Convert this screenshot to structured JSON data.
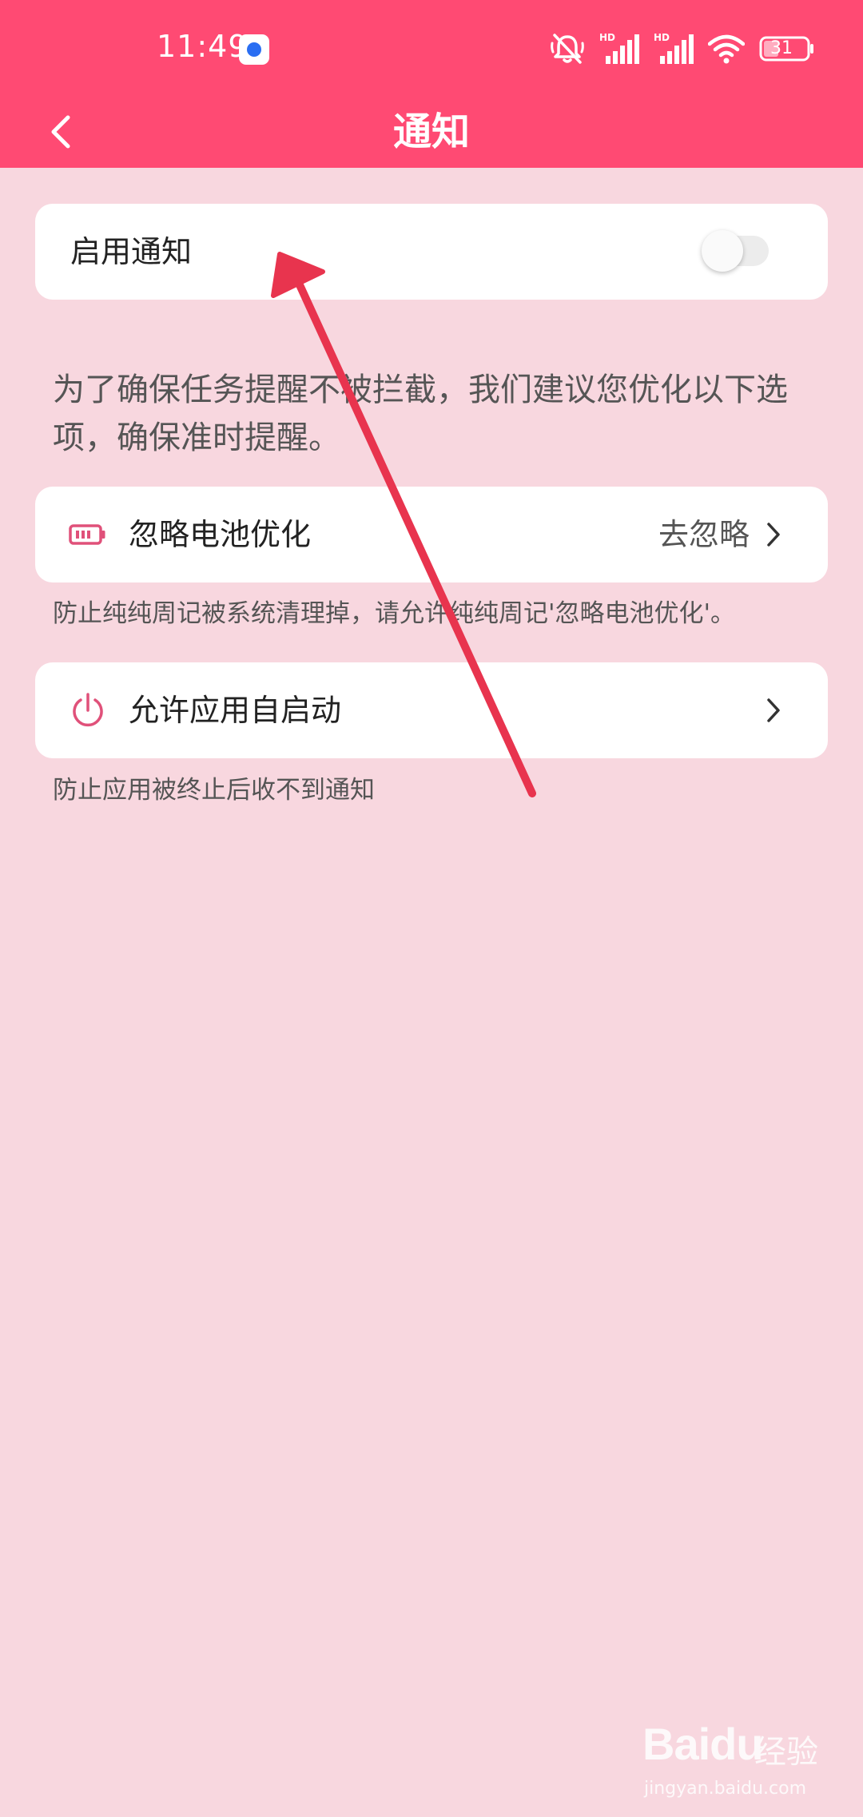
{
  "status_bar": {
    "time": "11:49",
    "battery_level": "31",
    "icons": [
      "app-notification-icon",
      "mute-icon",
      "signal-hd-icon",
      "signal-hd-icon",
      "wifi-icon",
      "battery-icon"
    ]
  },
  "nav": {
    "title": "通知",
    "back_icon": "chevron-left-icon"
  },
  "enable_notifications": {
    "label": "启用通知",
    "enabled": false
  },
  "hint": {
    "text": "为了确保任务提醒不被拦截，我们建议您优化以下选项，确保准时提醒。"
  },
  "battery_optimization": {
    "icon": "battery-icon",
    "label": "忽略电池优化",
    "action": "去忽略",
    "description": "防止纯纯周记被系统清理掉，请允许纯纯周记'忽略电池优化'。"
  },
  "auto_start": {
    "icon": "power-icon",
    "label": "允许应用自启动",
    "description": "防止应用被终止后收不到通知"
  },
  "watermark": {
    "brand": "Baidu",
    "product": "经验",
    "url": "jingyan.baidu.com"
  },
  "colors": {
    "header": "#ff4a73",
    "background": "#f8d7df",
    "card": "#ffffff",
    "icon_accent": "#e0517a",
    "annotation_arrow": "#e8344e"
  }
}
